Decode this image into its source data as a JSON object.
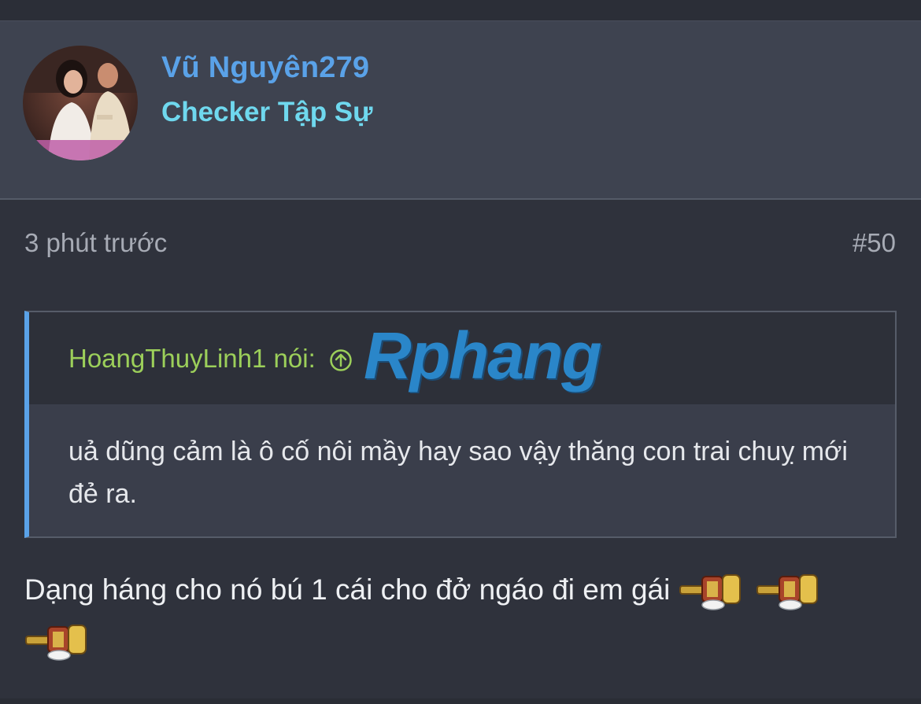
{
  "post": {
    "author": {
      "username": "Vũ Nguyên279",
      "title": "Checker Tập Sự"
    },
    "time": "3 phút trước",
    "number": "#50",
    "quote": {
      "author": "HoangThuyLinh1",
      "said": "nói:",
      "body": "uả dũng cảm là ô cố nôi mầy hay sao vậy thăng con trai chuỵ mới đẻ ra."
    },
    "message": "Dạng háng cho nó bú 1 cái cho đở ngáo đi em gái",
    "emoticons": [
      "key-emoticon",
      "key-emoticon",
      "key-emoticon"
    ]
  },
  "watermark": {
    "text": "Rphang"
  },
  "colors": {
    "username": "#5aa2e8",
    "usertitle": "#6fd8ee",
    "quote_author": "#9ccf5a",
    "quote_border": "#5aa2e8",
    "background": "#2f323c",
    "header_bg": "#3e4350"
  }
}
